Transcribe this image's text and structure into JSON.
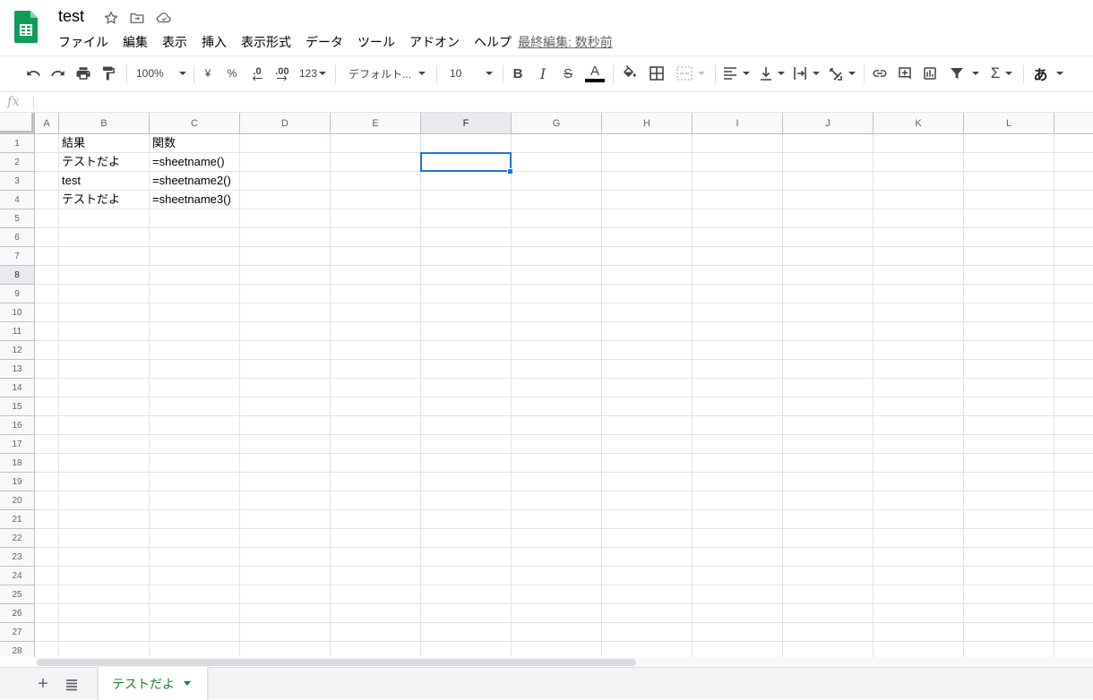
{
  "doc": {
    "title": "test",
    "last_edit": "最終編集: 数秒前"
  },
  "menu": {
    "items": [
      "ファイル",
      "編集",
      "表示",
      "挿入",
      "表示形式",
      "データ",
      "ツール",
      "アドオン",
      "ヘルプ"
    ]
  },
  "toolbar": {
    "zoom": "100%",
    "currency": "¥",
    "percent": "%",
    "decrease_decimal": ".0",
    "increase_decimal": ".00",
    "number_format": "123",
    "font": "デフォルト...",
    "font_size": "10",
    "input_tool": "あ",
    "icons": [
      "undo-icon",
      "redo-icon",
      "print-icon",
      "paint-format-icon",
      "bold-icon",
      "italic-icon",
      "strikethrough-icon",
      "text-color-icon",
      "fill-color-icon",
      "borders-icon",
      "merge-cells-icon",
      "horizontal-align-icon",
      "vertical-align-icon",
      "text-wrap-icon",
      "text-rotation-icon",
      "link-icon",
      "comment-icon",
      "chart-icon",
      "filter-icon",
      "functions-icon"
    ],
    "text_color_swatch": "#000000"
  },
  "formula_bar": {
    "fx_label": "fx",
    "value": ""
  },
  "grid": {
    "columns": [
      "A",
      "B",
      "C",
      "D",
      "E",
      "F",
      "G",
      "H",
      "I",
      "J",
      "K",
      "L"
    ],
    "rows": [
      "1",
      "2",
      "3",
      "4",
      "5",
      "6",
      "7",
      "8",
      "9",
      "10",
      "11",
      "12",
      "13",
      "14",
      "15",
      "16",
      "17",
      "18",
      "19",
      "20",
      "21",
      "22",
      "23",
      "24",
      "25",
      "26",
      "27",
      "28"
    ],
    "active_cell": "F8",
    "cells": {
      "B1": "結果",
      "C1": "関数",
      "B2": "テストだよ",
      "C2": "=sheetname()",
      "B3": "test",
      "C3": "=sheetname2()",
      "B4": "テストだよ",
      "C4": "=sheetname3()"
    }
  },
  "sheets": {
    "active_tab": "テストだよ"
  },
  "colors": {
    "brand_green": "#0f9d58",
    "selection_blue": "#1a73e8",
    "tab_green": "#188038"
  }
}
